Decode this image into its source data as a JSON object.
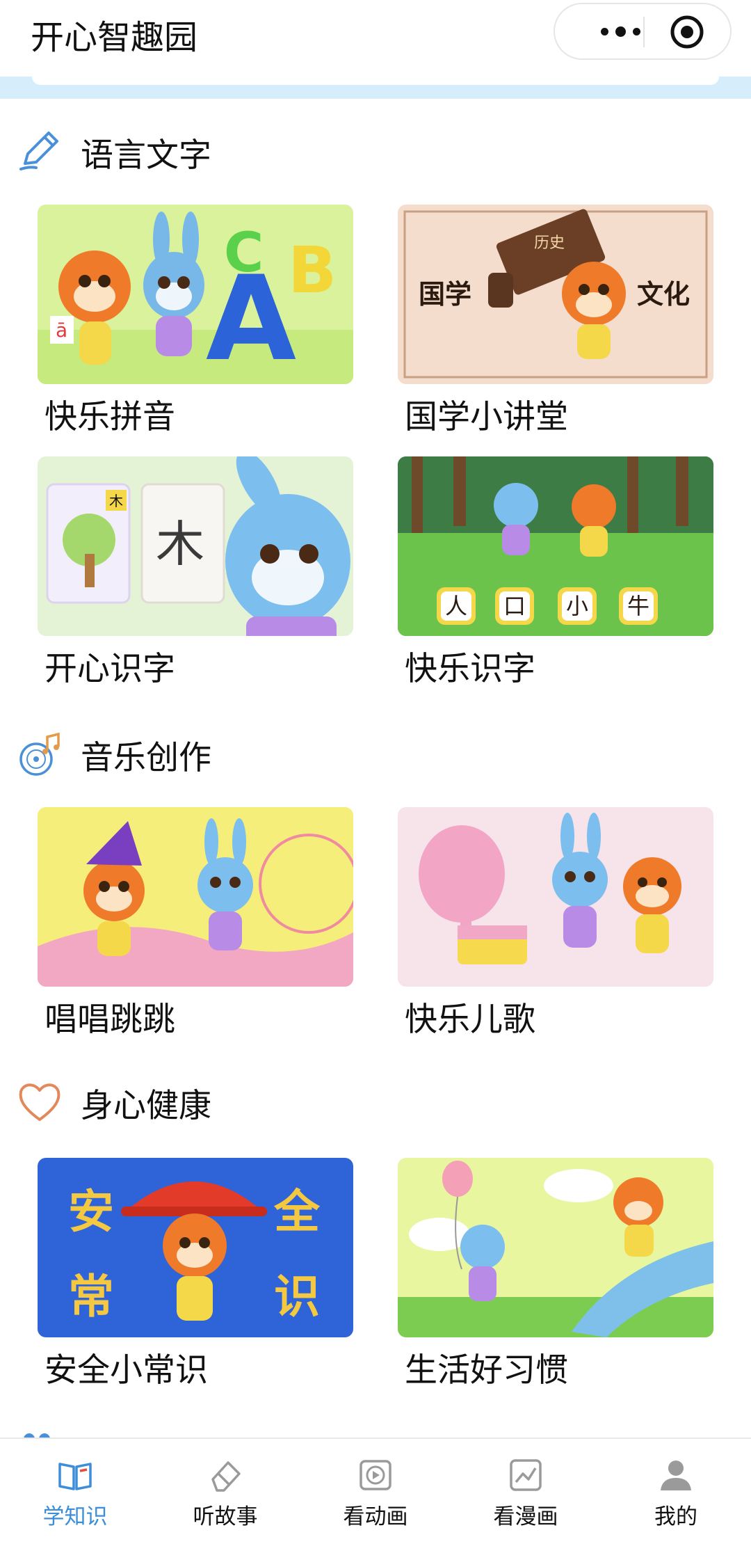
{
  "header": {
    "app_title": "开心智趣园"
  },
  "colors": {
    "accent": "#3d8ed8",
    "strip": "#d6eefb"
  },
  "sections": [
    {
      "icon": "pencil-icon",
      "title": "语言文字",
      "cards": [
        {
          "label": "快乐拼音",
          "thumb_text": [
            "ā",
            "A",
            "B",
            "C"
          ]
        },
        {
          "label": "国学小讲堂",
          "thumb_text": [
            "国学",
            "文化",
            "历史"
          ]
        },
        {
          "label": "开心识字",
          "thumb_text": [
            "木",
            "木"
          ]
        },
        {
          "label": "快乐识字",
          "thumb_text": [
            "人",
            "口",
            "小",
            "牛"
          ]
        }
      ]
    },
    {
      "icon": "music-disc-icon",
      "title": "音乐创作",
      "cards": [
        {
          "label": "唱唱跳跳",
          "thumb_text": []
        },
        {
          "label": "快乐儿歌",
          "thumb_text": []
        }
      ]
    },
    {
      "icon": "heart-icon",
      "title": "身心健康",
      "cards": [
        {
          "label": "安全小常识",
          "thumb_text": [
            "安",
            "全",
            "常",
            "识"
          ]
        },
        {
          "label": "生活好习惯",
          "thumb_text": []
        }
      ]
    }
  ],
  "tabbar": {
    "items": [
      {
        "label": "学知识",
        "icon": "book-icon",
        "active": true
      },
      {
        "label": "听故事",
        "icon": "eraser-icon",
        "active": false
      },
      {
        "label": "看动画",
        "icon": "video-play-icon",
        "active": false
      },
      {
        "label": "看漫画",
        "icon": "image-chart-icon",
        "active": false
      },
      {
        "label": "我的",
        "icon": "user-icon",
        "active": false
      }
    ]
  }
}
